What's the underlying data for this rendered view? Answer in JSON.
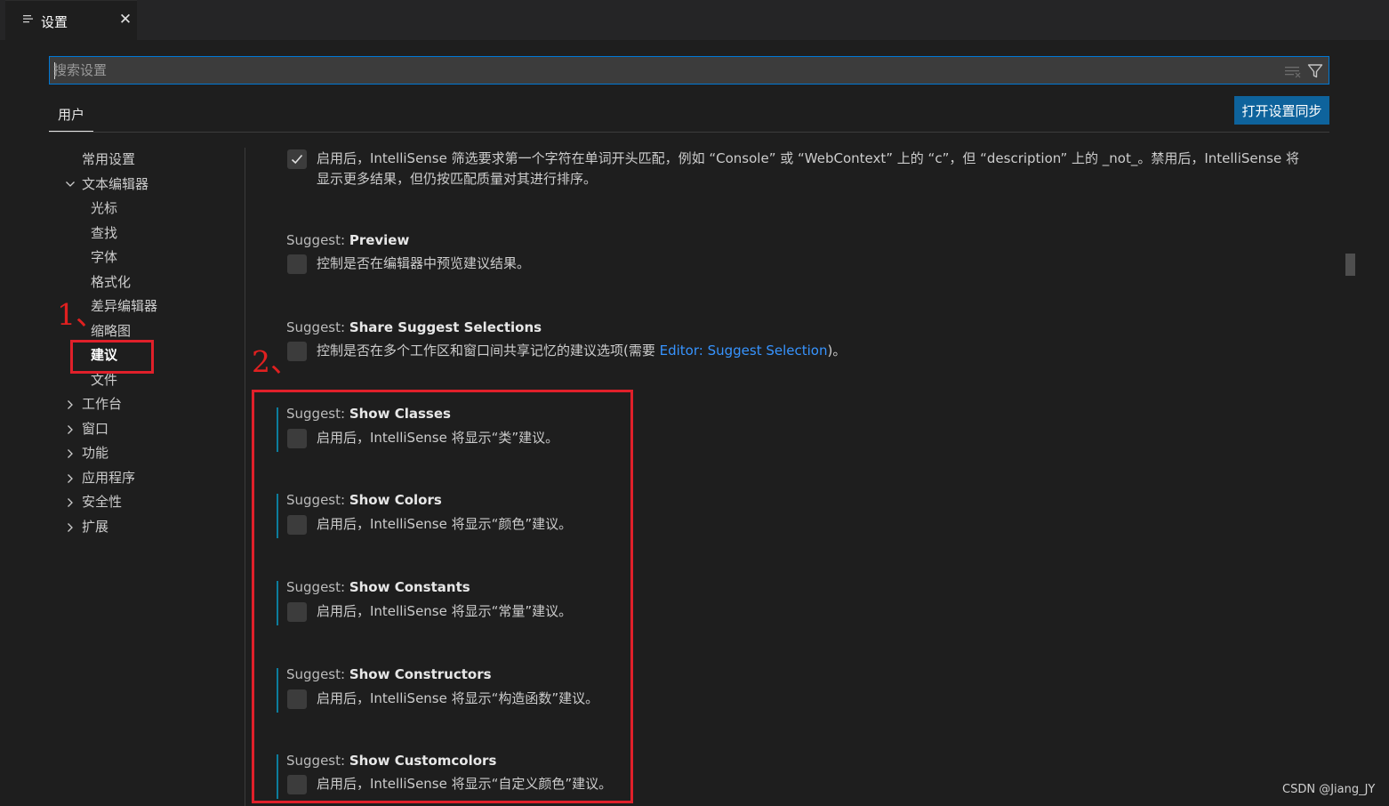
{
  "tab": {
    "title": "设置",
    "close": "✕"
  },
  "search": {
    "placeholder": "搜索设置"
  },
  "scope": {
    "user_tab": "用户",
    "sync_button": "打开设置同步"
  },
  "toc": {
    "items": [
      "常用设置",
      "文本编辑器",
      "光标",
      "查找",
      "字体",
      "格式化",
      "差异编辑器",
      "缩略图",
      "建议",
      "文件",
      "工作台",
      "窗口",
      "功能",
      "应用程序",
      "安全性",
      "扩展"
    ]
  },
  "settings": {
    "first_desc_line1": "启用后，IntelliSense 筛选要求第一个字符在单词开头匹配，例如 “Console” 或 “WebContext” 上的 “c”，但 “description” 上的 _not_。禁用后，IntelliSense 将",
    "first_desc_line2": "显示更多结果，但仍按匹配质量对其进行排序。",
    "category": "Suggest: ",
    "preview_name": "Preview",
    "preview_desc": "控制是否在编辑器中预览建议结果。",
    "share_name": "Share Suggest Selections",
    "share_desc_before": "控制是否在多个工作区和窗口间共享记忆的建议选项(需要 ",
    "share_link": "Editor: Suggest Selection",
    "share_desc_after": ")。",
    "classes_name": "Show Classes",
    "classes_desc": "启用后，IntelliSense 将显示“类”建议。",
    "colors_name": "Show Colors",
    "colors_desc": "启用后，IntelliSense 将显示“颜色”建议。",
    "constants_name": "Show Constants",
    "constants_desc": "启用后，IntelliSense 将显示“常量”建议。",
    "constructors_name": "Show Constructors",
    "constructors_desc": "启用后，IntelliSense 将显示“构造函数”建议。",
    "customcolors_name": "Show Customcolors",
    "customcolors_desc": "启用后，IntelliSense 将显示“自定义颜色”建议。"
  },
  "annotations": {
    "one": "1、",
    "two": "2、"
  },
  "watermark": "CSDN @Jiang_JY",
  "colors": {
    "accent": "#0078d4",
    "button": "#0e639c",
    "link": "#3794ff",
    "annotation": "#e02020",
    "modified": "#0c7d9d"
  }
}
